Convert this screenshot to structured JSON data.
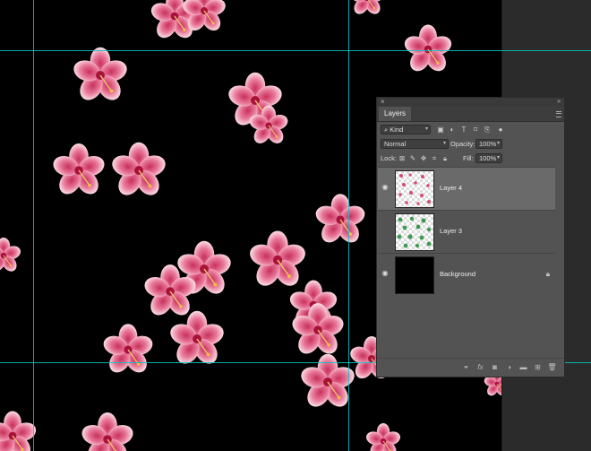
{
  "canvas": {
    "background": "#000000",
    "guide_color": "#00c8c8"
  },
  "panel": {
    "tab": "Layers",
    "filter": {
      "kind_label": "Kind",
      "icons": [
        "pixel-filter-icon",
        "adjustment-filter-icon",
        "type-filter-icon",
        "shape-filter-icon",
        "smart-object-filter-icon",
        "filter-toggle-icon"
      ]
    },
    "blend_mode": "Normal",
    "opacity_label": "Opacity:",
    "opacity_value": "100%",
    "lock_label": "Lock:",
    "fill_label": "Fill:",
    "fill_value": "100%",
    "layers": [
      {
        "name": "Layer 4",
        "visible": true,
        "selected": true
      },
      {
        "name": "Layer 3",
        "visible": false,
        "selected": false
      },
      {
        "name": "Background",
        "visible": true,
        "selected": false,
        "locked": true
      }
    ],
    "footer_icons": [
      "link-layers-icon",
      "fx-icon",
      "mask-icon",
      "adjustment-layer-icon",
      "group-folder-icon",
      "new-layer-icon",
      "trash-icon"
    ],
    "colors": {
      "panel_bg": "#535353",
      "selected_row": "#6a6a6a"
    }
  }
}
